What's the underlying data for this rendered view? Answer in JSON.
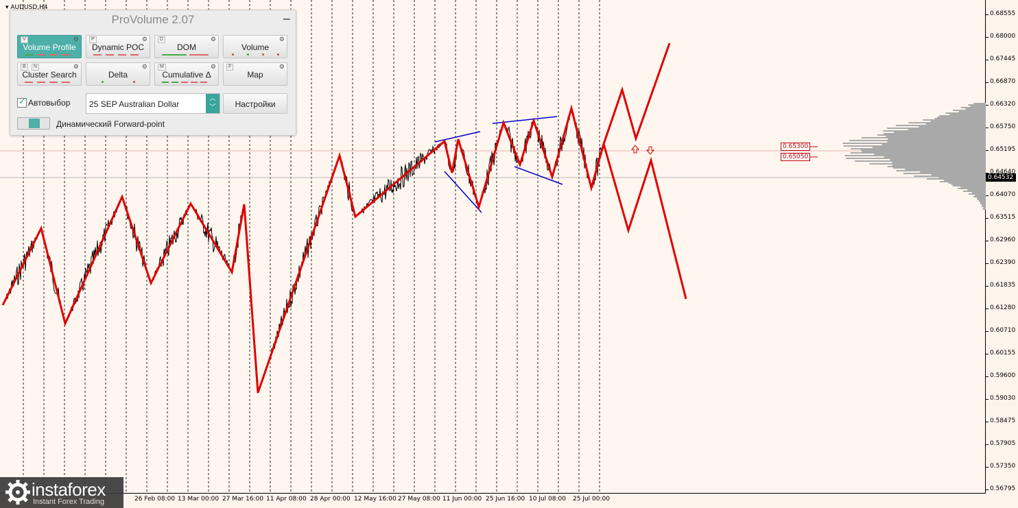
{
  "symbol": "AUDUSD,H4",
  "current_price": "0.64532",
  "levels": [
    "0.65300",
    "0.65050"
  ],
  "price_labels": [
    "0.68555",
    "0.68000",
    "0.67445",
    "0.66870",
    "0.66320",
    "0.65750",
    "0.65195",
    "0.64640",
    "0.64070",
    "0.63515",
    "0.62960",
    "0.62390",
    "0.61835",
    "0.61280",
    "0.60710",
    "0.60155",
    "0.59600",
    "0.59030",
    "0.58475",
    "0.57905",
    "0.57350",
    "0.56795"
  ],
  "time_labels": [
    "26 Feb 08:00",
    "13 Mar 00:00",
    "27 Mar 16:00",
    "11 Apr 08:00",
    "28 Apr 00:00",
    "12 May 16:00",
    "27 May 08:00",
    "11 Jun 00:00",
    "25 Jun 16:00",
    "10 Jul 08:00",
    "25 Jul 00:00"
  ],
  "panel": {
    "title": "ProVolume 2.07",
    "buttons": [
      {
        "label": "Volume Profile",
        "key": "V"
      },
      {
        "label": "Dynamic POC",
        "key": "P"
      },
      {
        "label": "DOM",
        "key": "D"
      },
      {
        "label": "Volume",
        "key": ""
      },
      {
        "label": "Cluster Search",
        "key": "B",
        "key2": "N"
      },
      {
        "label": "Delta",
        "key": ""
      },
      {
        "label": "Cumulative Δ",
        "key": "M"
      },
      {
        "label": "Map",
        "key": "F"
      }
    ],
    "auto_select_label": "Автовыбор",
    "instrument": "25 SEP Australian Dollar",
    "settings_label": "Настройки",
    "forward_label": "Динамический Forward-point"
  },
  "logo": {
    "name": "instaforex",
    "tagline": "Instant Forex Trading"
  },
  "colors": {
    "zigzag": "#e00000",
    "channel": "#0000cc",
    "price": "#000000",
    "accent": "#4dafa8"
  }
}
